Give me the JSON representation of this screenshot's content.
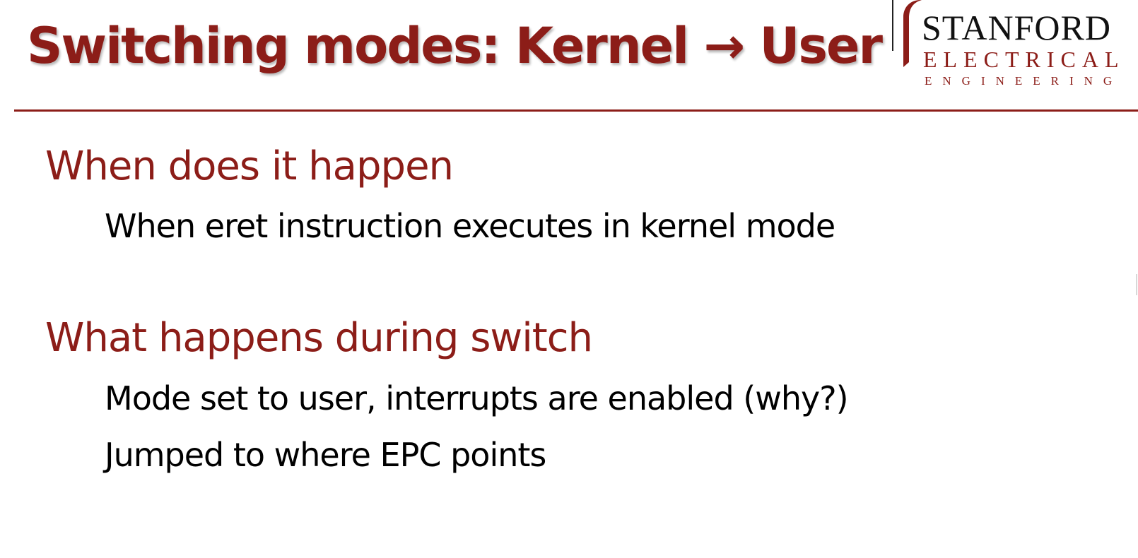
{
  "slide": {
    "title": "Switching modes: Kernel → User"
  },
  "logo": {
    "line1": "STANFORD",
    "line2": "ELECTRICAL",
    "line3": "ENGINEERING",
    "mark_color": "#8c1d18"
  },
  "sections": [
    {
      "heading": "When does it happen",
      "bullets": [
        "When eret instruction executes in kernel mode"
      ]
    },
    {
      "heading": "What happens during switch",
      "bullets": [
        "Mode set to user, interrupts are enabled (why?)",
        "Jumped to where EPC points"
      ]
    }
  ],
  "colors": {
    "accent": "#8c1d18",
    "text": "#000000",
    "background": "#ffffff"
  }
}
